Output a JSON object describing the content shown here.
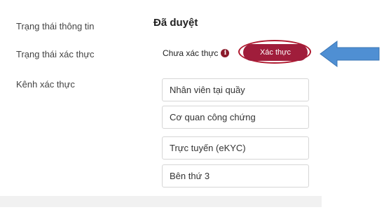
{
  "info_status": {
    "label": "Trạng thái thông tin",
    "value": "Đã duyệt"
  },
  "verify_status": {
    "label": "Trạng thái xác thực",
    "value": "Chưa xác thực",
    "info_icon": "info-icon",
    "button_label": "Xác thực",
    "button_color": "#a01d3b",
    "highlight_color": "#b01a30",
    "arrow_color": "#4f8fd3"
  },
  "channels": {
    "label": "Kênh xác thực",
    "options": [
      "Nhân viên tại quầy",
      "Cơ quan công chứng",
      "Trực tuyến (eKYC)",
      "Bên thứ 3"
    ]
  }
}
